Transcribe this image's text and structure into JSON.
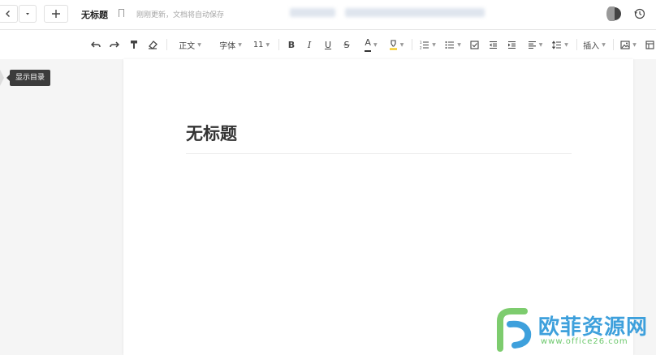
{
  "topbar": {
    "doc_tab_title": "无标题",
    "save_status": "刚刚更新，文档将自动保存"
  },
  "toolbar": {
    "paragraph_style": "正文",
    "font_family": "字体",
    "font_size": "11",
    "bold": "B",
    "italic": "I",
    "underline": "U",
    "strike": "S",
    "font_color": "A",
    "insert": "插入"
  },
  "outline_tooltip": "显示目录",
  "document": {
    "heading": "无标题"
  },
  "watermark": {
    "text": "欧菲资源网",
    "url": "www.office26.com"
  },
  "colors": {
    "watermark_blue": "#3ea0dc",
    "watermark_green": "#6cc86c",
    "font_color_bar": "#333333",
    "highlight_bar": "#f2c200"
  }
}
